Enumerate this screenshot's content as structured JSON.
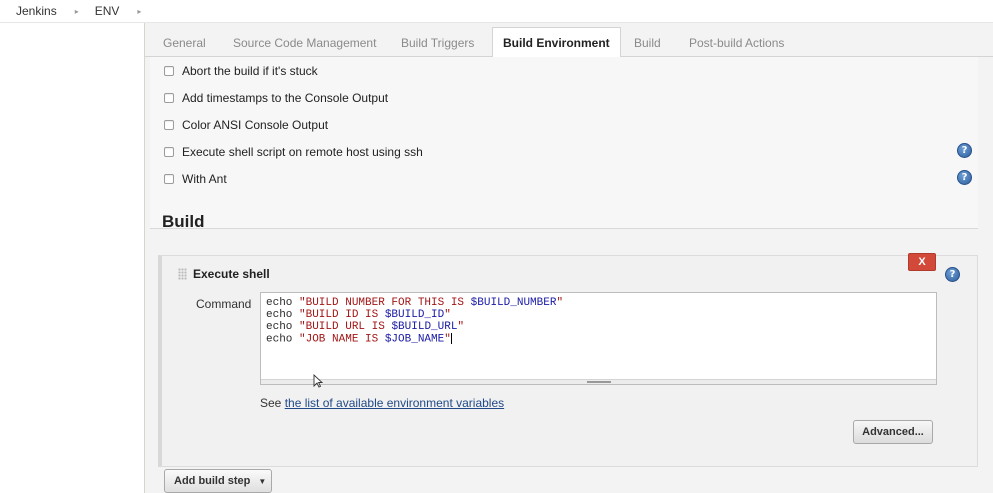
{
  "breadcrumb": {
    "items": [
      "Jenkins",
      "ENV"
    ]
  },
  "tabs": [
    {
      "label": "General",
      "active": false
    },
    {
      "label": "Source Code Management",
      "active": false
    },
    {
      "label": "Build Triggers",
      "active": false
    },
    {
      "label": "Build Environment",
      "active": true
    },
    {
      "label": "Build",
      "active": false
    },
    {
      "label": "Post-build Actions",
      "active": false
    }
  ],
  "build_environment": {
    "options": [
      {
        "label": "Abort the build if it's stuck",
        "checked": false
      },
      {
        "label": "Add timestamps to the Console Output",
        "checked": false
      },
      {
        "label": "Color ANSI Console Output",
        "checked": false
      },
      {
        "label": "Execute shell script on remote host using ssh",
        "checked": false
      },
      {
        "label": "With Ant",
        "checked": false
      }
    ],
    "help_glyph": "?"
  },
  "build": {
    "heading": "Build",
    "step": {
      "title": "Execute shell",
      "delete_label": "X",
      "command_label": "Command",
      "command_lines": [
        {
          "kw": "echo",
          "str": " \"BUILD NUMBER FOR THIS IS ",
          "var": "$BUILD_NUMBER",
          "end": "\""
        },
        {
          "kw": "echo",
          "str": " \"BUILD ID IS ",
          "var": "$BUILD_ID",
          "end": "\""
        },
        {
          "kw": "echo",
          "str": " \"BUILD URL IS ",
          "var": "$BUILD_URL",
          "end": "\""
        },
        {
          "kw": "echo",
          "str": " \"JOB NAME IS ",
          "var": "$JOB_NAME",
          "end": "\""
        }
      ],
      "see_prefix": "See ",
      "see_link": "the list of available environment variables",
      "advanced_label": "Advanced..."
    },
    "add_step_label": "Add build step"
  },
  "colors": {
    "delete_button": "#d24939",
    "link": "#204a87",
    "help_icon": "#2f5f9e"
  }
}
